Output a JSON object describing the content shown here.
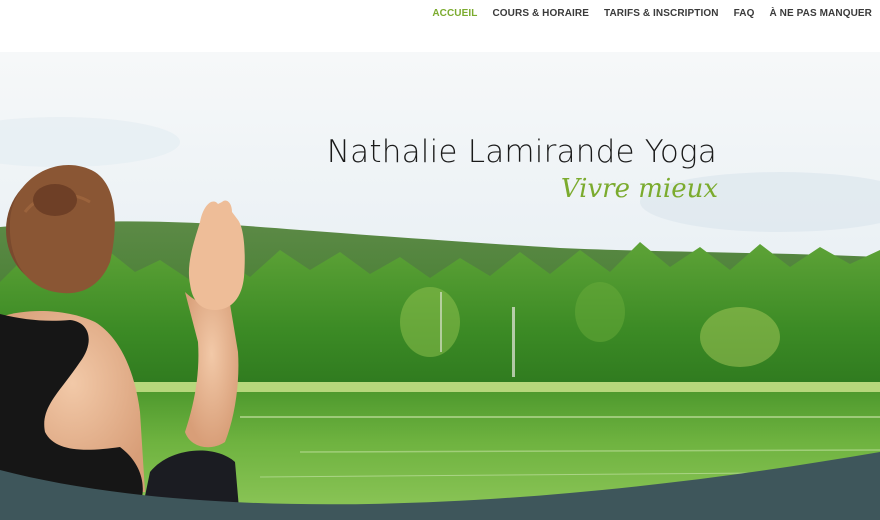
{
  "nav": {
    "items": [
      {
        "label": "ACCUEIL",
        "active": true
      },
      {
        "label": "COURS & HORAIRE",
        "active": false
      },
      {
        "label": "TARIFS & INSCRIPTION",
        "active": false
      },
      {
        "label": "FAQ",
        "active": false
      },
      {
        "label": "À NE PAS MANQUER",
        "active": false
      }
    ],
    "active_color": "#7bab2e"
  },
  "hero": {
    "title": "Nathalie Lamirande Yoga",
    "tagline": "Vivre mieux"
  },
  "colors": {
    "accent": "#7bab2e",
    "wave": "#3e565b"
  }
}
